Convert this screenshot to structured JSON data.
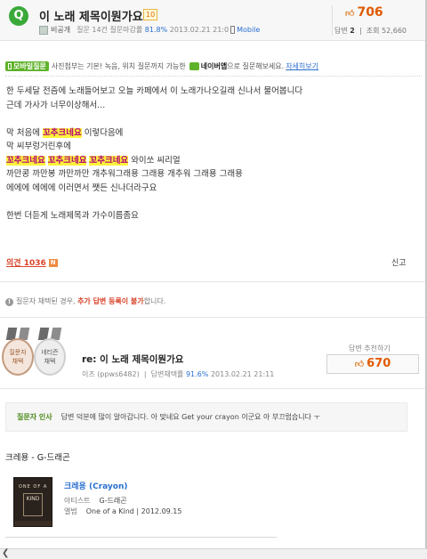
{
  "question": {
    "badge": "Q",
    "title": "이 노래 제목이뭔가요",
    "level": "10",
    "user": "비공개",
    "meta": "질문 14건 질문마감률",
    "close_rate": "81.8%",
    "date": "2013.02.21 21:0",
    "mobile": "Mobile",
    "recommend": "706",
    "answers_label": "답변",
    "answers": "2",
    "views_label": "조회",
    "views": "52,660"
  },
  "mobile_bar": {
    "tag": "모바일질문",
    "text": "사진첨부는 기본! 녹음, 위치 질문까지 가능한",
    "brand": "네이버앱",
    "suffix": "으로 질문해보세요.",
    "more": "자세히보기"
  },
  "body": {
    "l1": "한 두세달 전즘에 노래들어보고 오늘 카페에서 이 노래가나오길래 신나서 물어봅니다",
    "l2": "근데 가사가 너무이상해서...",
    "l3_hl": "꼬추크네요",
    "l3_pre": "막 처음에 ",
    "l3_post": " 이렇다음에",
    "l4": "막 씨부렁거린후에",
    "l5_a": "꼬추크네요",
    "l5_b": "꼬추크네요",
    "l5_c": "꼬추크네요",
    "l5_post": " 와이쏘 씨리얼",
    "l6": "까만콩 까만봉 까만까만 개추워그래용 그래용 개추워 그래용 그래용",
    "l7": "에에에 에에에 이러면서 쨋든 신나더라구요",
    "l8": "한번 더듣게 노래제목과 가수이름좀요"
  },
  "actions": {
    "opinion": "의견",
    "opinion_count": "1036",
    "opinion_badge": "N",
    "report": "신고"
  },
  "notice": {
    "pre": "질문자 채택된 경우,",
    "red": "추가 답변 등록이 불가",
    "post": "합니다."
  },
  "answer": {
    "medal1": [
      "질문자",
      "채택"
    ],
    "medal2": [
      "네티즌",
      "채택"
    ],
    "title": "re: 이 노래 제목이뭔가요",
    "author": "이즈 (ppws6482)",
    "rate_label": "답변채택률",
    "rate": "91.6%",
    "date": "2013.02.21 21:11",
    "recommend_label": "답변 추천하기",
    "recommend": "670",
    "thanks_label": "질문자 인사",
    "thanks_text": "답변 덕분에 많이 알아갑니다. 아 맞네요 Get your crayon 이군요 아 부끄럽습니다 ㅜ",
    "song_heading": "크레용 - G-드래곤",
    "album_text1": "ONE OF A",
    "album_text2": "KIND",
    "album_title": "크레용 (Crayon)",
    "artist_label": "아티스트",
    "artist": "G-드래곤",
    "album_label": "앨범",
    "album": "One of a Kind | 2012.09.15"
  },
  "colors": {
    "accent": "#e05a00",
    "link": "#2a6fd0",
    "highlight": "#fff23c",
    "green": "#5fb32a"
  }
}
